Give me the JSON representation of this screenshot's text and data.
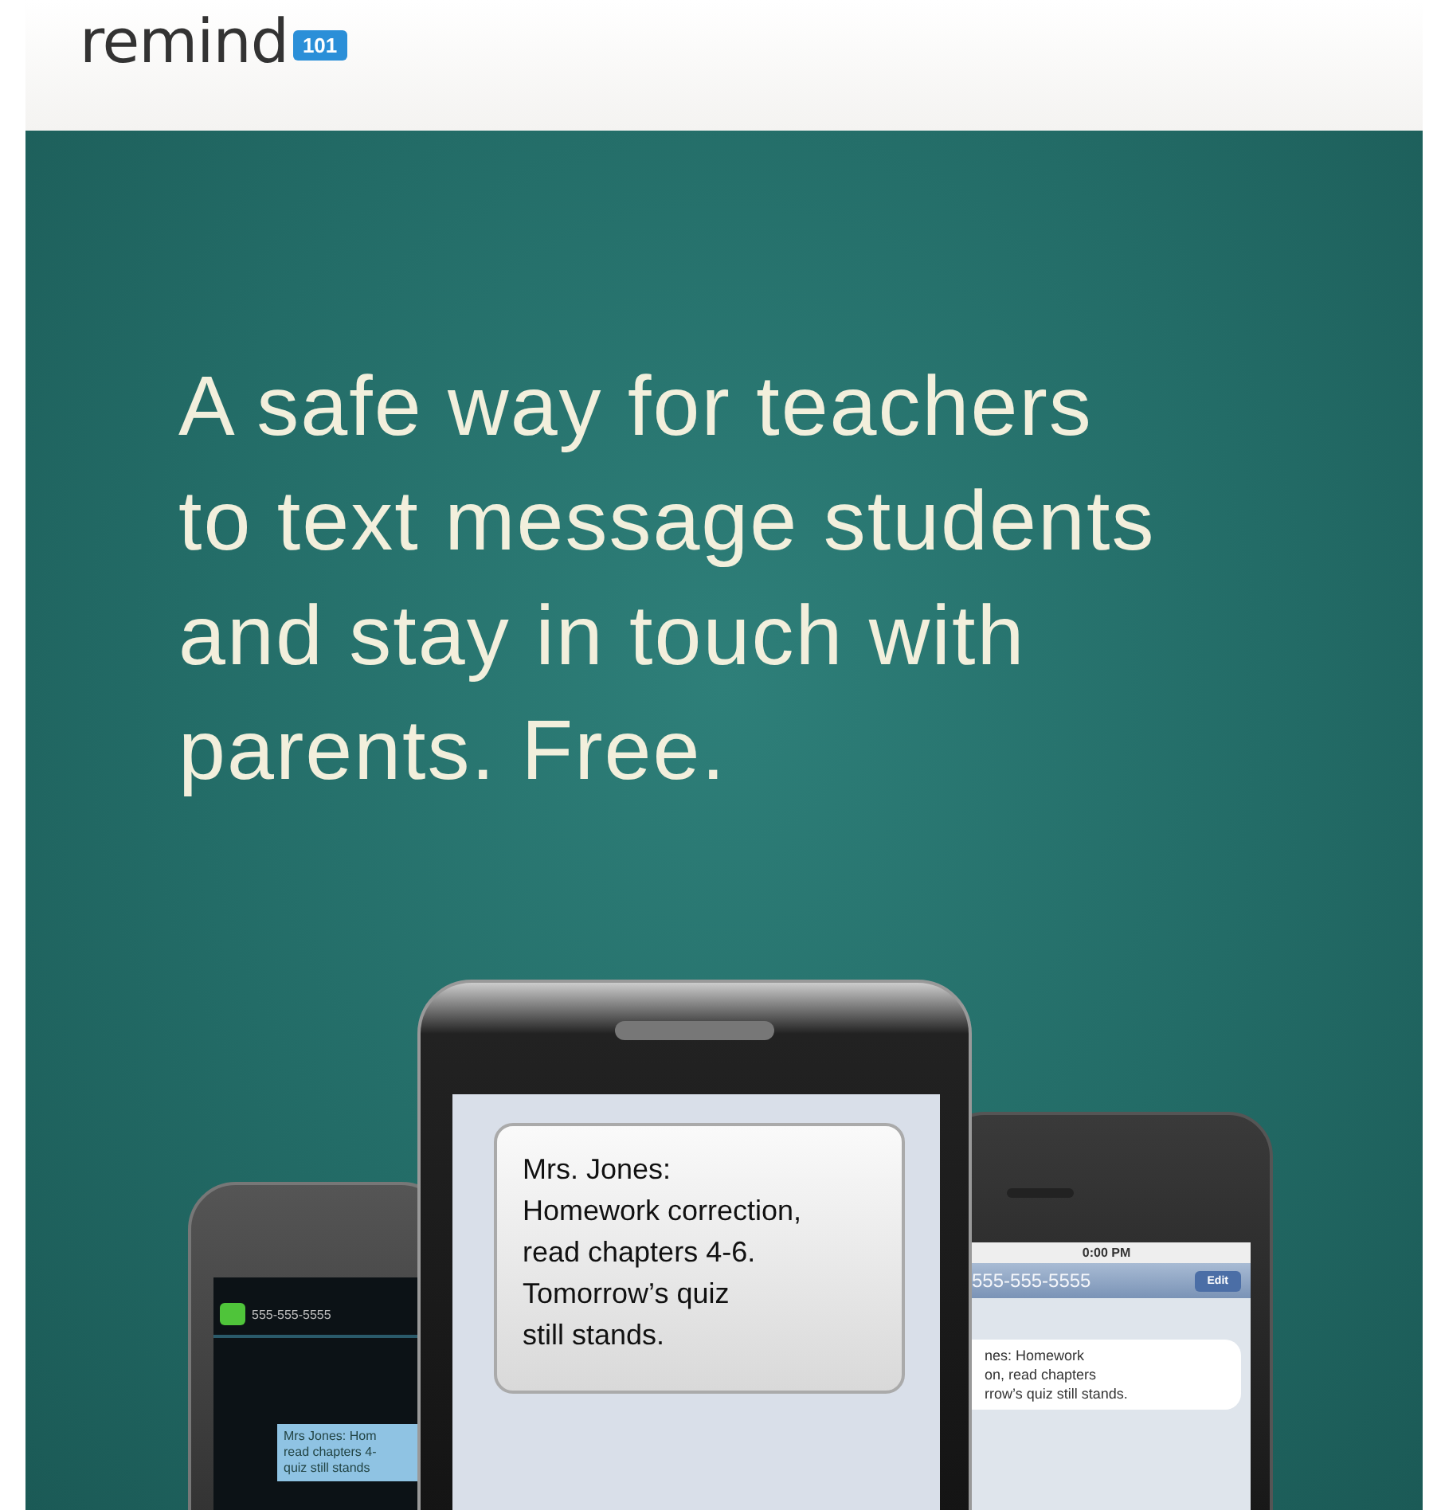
{
  "header": {
    "logo": {
      "wordmark": "remind",
      "badge": "101"
    }
  },
  "hero": {
    "headline_lines": [
      "A safe way for teachers",
      "to text message students",
      "and stay in touch with",
      "parents. Free."
    ],
    "phones": {
      "left": {
        "contact": "555-555-5555",
        "message_lines": [
          "Mrs Jones: Hom",
          "read chapters 4-",
          "quiz still stands"
        ]
      },
      "center": {
        "message_lines": [
          "Mrs. Jones:",
          "Homework correction,",
          "read chapters 4-6.",
          "Tomorrow’s quiz",
          "still stands."
        ]
      },
      "right": {
        "time": "0:00 PM",
        "contact": "555-555-5555",
        "button": "Edit",
        "message_lines": [
          "nes: Homework",
          "on, read chapters",
          "rrow’s quiz still stands."
        ]
      }
    }
  }
}
